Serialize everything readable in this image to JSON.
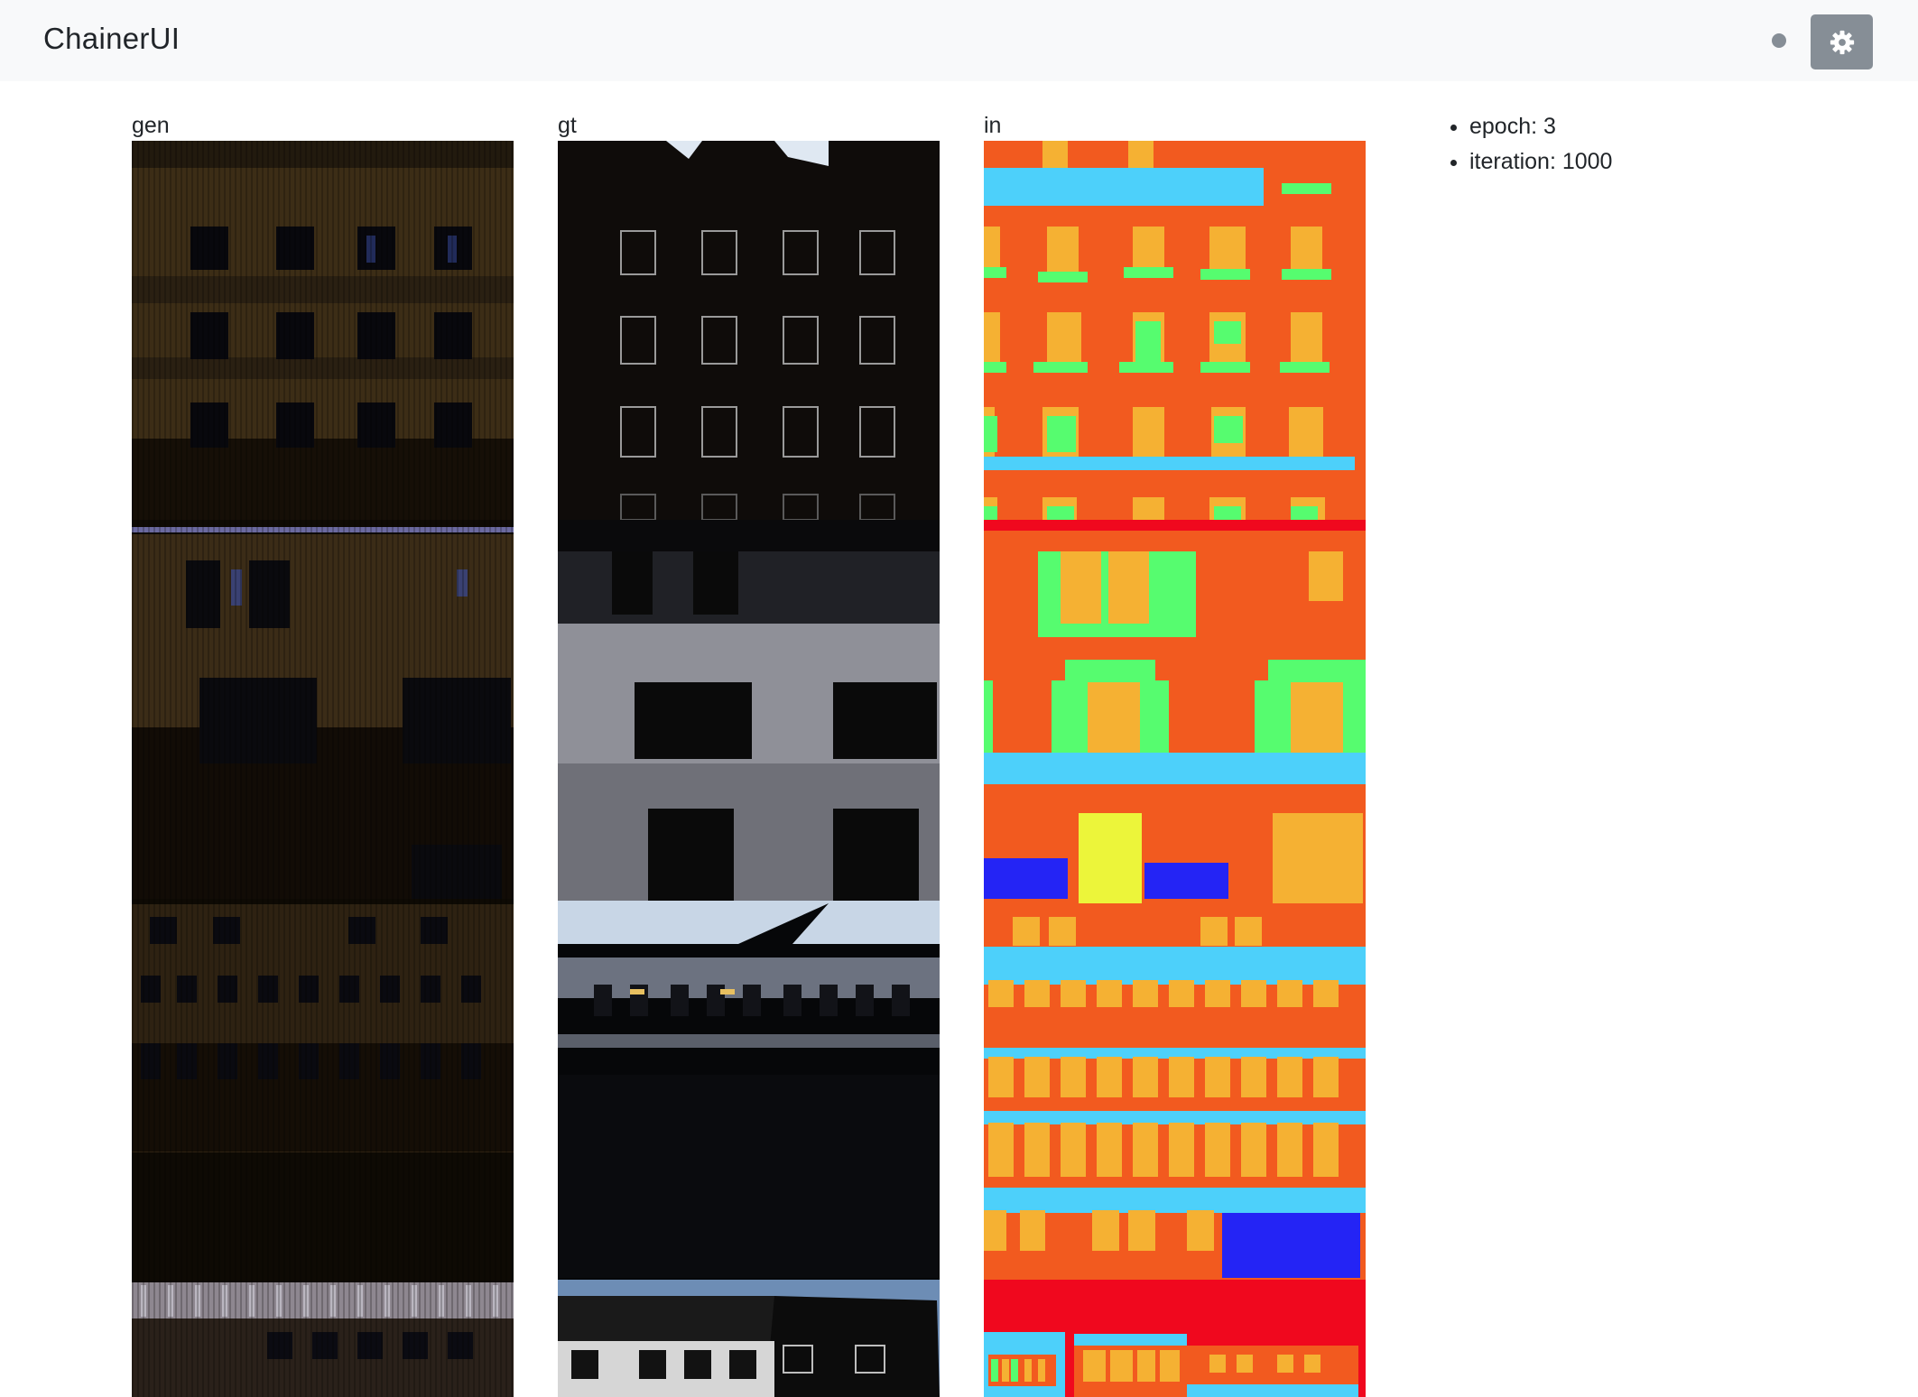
{
  "navbar": {
    "brand": "ChainerUI",
    "status_icon": "status-dot-icon",
    "settings_icon": "gear-icon"
  },
  "columns": [
    {
      "label": "gen"
    },
    {
      "label": "gt"
    },
    {
      "label": "in"
    }
  ],
  "meta": [
    {
      "key": "epoch",
      "value": "3",
      "text": "epoch: 3"
    },
    {
      "key": "iteration",
      "value": "1000",
      "text": "iteration: 1000"
    }
  ],
  "colors": {
    "navbar_bg": "#f8f9fa",
    "button_bg": "#868e96",
    "label_facade": "#f25a1f",
    "label_window": "#f5b133",
    "label_sill": "#56fc6f",
    "label_cornice": "#4dd0fa",
    "label_door": "#2424f5",
    "label_deco": "#ecf53a",
    "label_shop": "#f0081e"
  }
}
